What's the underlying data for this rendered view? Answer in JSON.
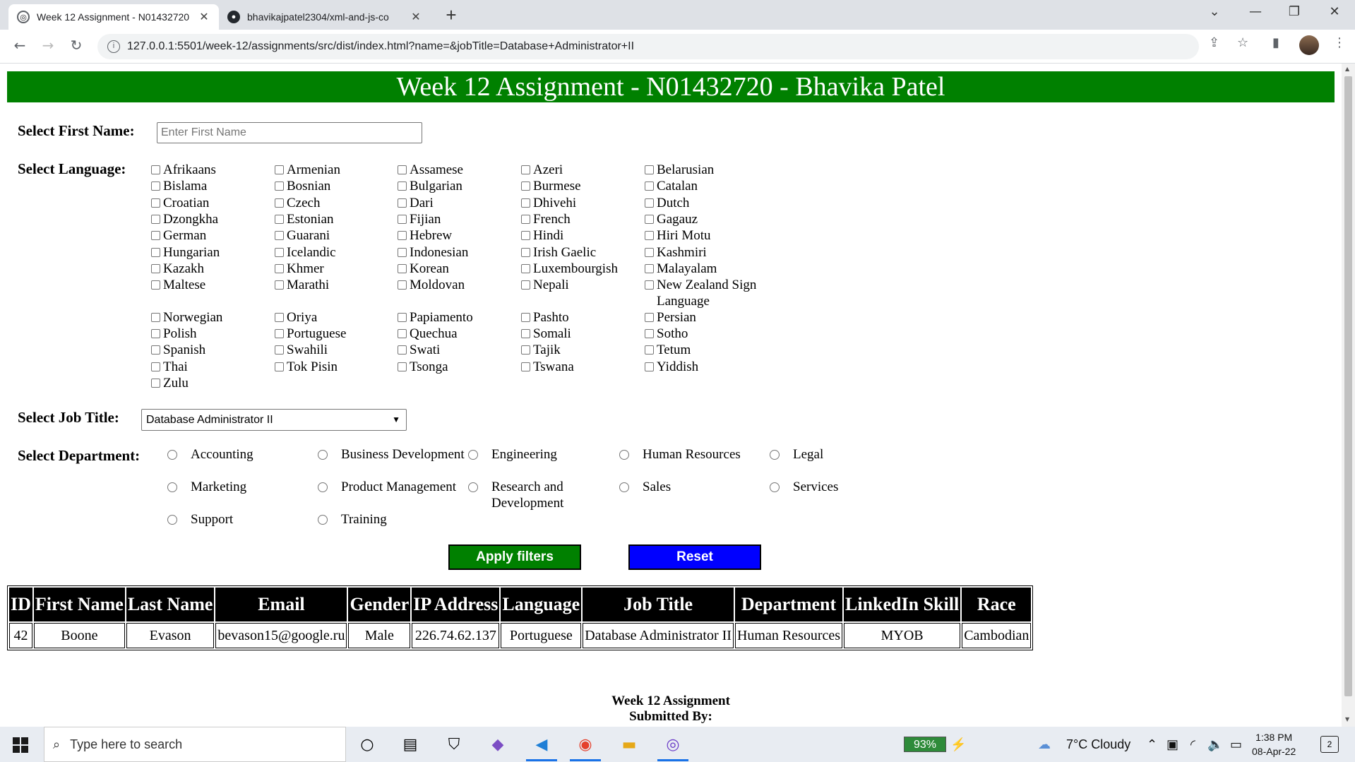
{
  "browser": {
    "tabs": [
      {
        "title": "Week 12 Assignment - N01432720 - Bhavika Patel",
        "active": true
      },
      {
        "title": "bhavikajpatel2304/xml-and-js-co",
        "active": false
      }
    ],
    "url": "127.0.0.1:5501/week-12/assignments/src/dist/index.html?name=&jobTitle=Database+Administrator+II",
    "new_tab": "+",
    "win_min": "⌄",
    "win_minimize": "—",
    "win_restore": "❐",
    "win_close": "✕"
  },
  "page": {
    "header": "Week 12 Assignment - N01432720 - Bhavika Patel",
    "first_name_label": "Select First Name:",
    "first_name_placeholder": "Enter First Name",
    "first_name_value": "",
    "language_label": "Select Language:",
    "languages": [
      "Afrikaans",
      "Armenian",
      "Assamese",
      "Azeri",
      "Belarusian",
      "Bislama",
      "Bosnian",
      "Bulgarian",
      "Burmese",
      "Catalan",
      "Croatian",
      "Czech",
      "Dari",
      "Dhivehi",
      "Dutch",
      "Dzongkha",
      "Estonian",
      "Fijian",
      "French",
      "Gagauz",
      "German",
      "Guarani",
      "Hebrew",
      "Hindi",
      "Hiri Motu",
      "Hungarian",
      "Icelandic",
      "Indonesian",
      "Irish Gaelic",
      "Kashmiri",
      "Kazakh",
      "Khmer",
      "Korean",
      "Luxembourgish",
      "Malayalam",
      "Maltese",
      "Marathi",
      "Moldovan",
      "Nepali",
      "New Zealand Sign Language",
      "Norwegian",
      "Oriya",
      "Papiamento",
      "Pashto",
      "Persian",
      "Polish",
      "Portuguese",
      "Quechua",
      "Somali",
      "Sotho",
      "Spanish",
      "Swahili",
      "Swati",
      "Tajik",
      "Tetum",
      "Thai",
      "Tok Pisin",
      "Tsonga",
      "Tswana",
      "Yiddish",
      "Zulu"
    ],
    "job_title_label": "Select Job Title:",
    "job_title_selected": "Database Administrator II",
    "department_label": "Select Department:",
    "departments": [
      "Accounting",
      "Business Development",
      "Engineering",
      "Human Resources",
      "Legal",
      "Marketing",
      "Product Management",
      "Research and Development",
      "Sales",
      "Services",
      "Support",
      "Training"
    ],
    "apply_label": "Apply filters",
    "reset_label": "Reset",
    "table": {
      "headers": [
        "ID",
        "First Name",
        "Last Name",
        "Email",
        "Gender",
        "IP Address",
        "Language",
        "Job Title",
        "Department",
        "LinkedIn Skill",
        "Race"
      ],
      "rows": [
        [
          "42",
          "Boone",
          "Evason",
          "bevason15@google.ru",
          "Male",
          "226.74.62.137",
          "Portuguese",
          "Database Administrator II",
          "Human Resources",
          "MYOB",
          "Cambodian"
        ]
      ]
    },
    "footer_line1": "Week 12 Assignment",
    "footer_line2": "Submitted By:"
  },
  "taskbar": {
    "search_placeholder": "Type here to search",
    "battery": "93%",
    "weather": "7°C  Cloudy",
    "time": "1:38 PM",
    "date": "08-Apr-22",
    "notifications": "2"
  },
  "colors": {
    "header_bg": "#008000",
    "apply_bg": "#008000",
    "reset_bg": "#0000ff",
    "table_header_bg": "#000000"
  }
}
